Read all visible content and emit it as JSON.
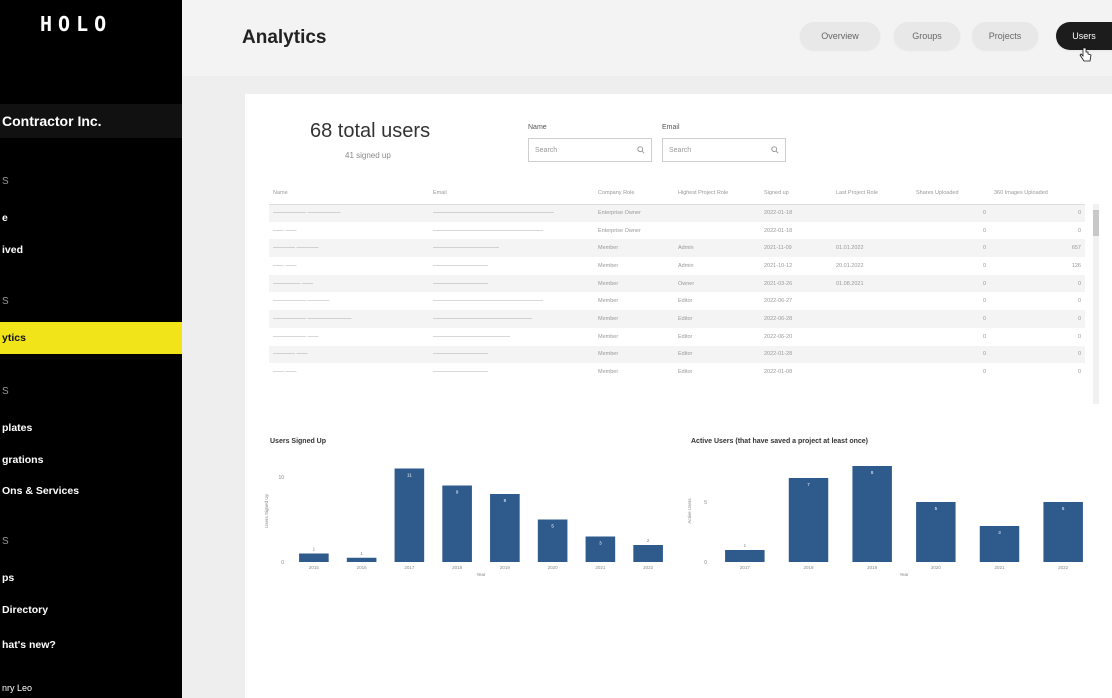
{
  "sidebar": {
    "logo": "HOLO",
    "org": "Contractor Inc.",
    "sections": [
      "S",
      "S",
      "S",
      "S"
    ],
    "items": [
      {
        "label": "e"
      },
      {
        "label": "ived"
      },
      {
        "label": "ytics"
      },
      {
        "label": "plates"
      },
      {
        "label": "grations"
      },
      {
        "label": "Ons & Services"
      },
      {
        "label": "ps"
      },
      {
        "label": "Directory"
      },
      {
        "label": "hat's new?"
      },
      {
        "label": "nry Leo"
      }
    ]
  },
  "header": {
    "title": "Analytics",
    "tabs": [
      {
        "label": "Overview"
      },
      {
        "label": "Groups"
      },
      {
        "label": "Projects"
      },
      {
        "label": "Users"
      }
    ],
    "active_tab": "Users"
  },
  "summary": {
    "total_users": "68 total users",
    "signed_up": "41 signed up"
  },
  "filters": {
    "name_label": "Name",
    "name_placeholder": "Search",
    "email_label": "Email",
    "email_placeholder": "Search"
  },
  "table": {
    "columns": [
      "Name",
      "Email",
      "Company Role",
      "Highest Project Role",
      "Signed up",
      "Last Project Role",
      "Shares Uploaded",
      "360 Images Uploaded"
    ],
    "rows": [
      [
        "—————— ——————",
        "——————————————————————",
        "Enterprise Owner",
        "",
        "2022-01-18",
        "",
        "0",
        "0"
      ],
      [
        "—— ——",
        "————————————————————",
        "Enterprise Owner",
        "",
        "2022-01-18",
        "",
        "0",
        "0"
      ],
      [
        "———— ————",
        "————————————",
        "Member",
        "Admin",
        "2021-11-09",
        "01.01.2022",
        "0",
        "657"
      ],
      [
        "—— ——",
        "——————————",
        "Member",
        "Admin",
        "2021-10-12",
        "20.01.2022",
        "0",
        "126"
      ],
      [
        "————— ——",
        "——————————",
        "Member",
        "Owner",
        "2021-03-26",
        "01.08.2021",
        "0",
        "0"
      ],
      [
        "—————— ————",
        "————————————————————",
        "Member",
        "Editor",
        "2022-06-27",
        "",
        "0",
        "0"
      ],
      [
        "—————— ————————",
        "——————————————————",
        "Member",
        "Editor",
        "2022-06-28",
        "",
        "0",
        "0"
      ],
      [
        "—————— ——",
        "——————————————",
        "Member",
        "Editor",
        "2022-06-20",
        "",
        "0",
        "0"
      ],
      [
        "———— ——",
        "——————————",
        "Member",
        "Editor",
        "2022-01-28",
        "",
        "0",
        "0"
      ],
      [
        "—— ——",
        "——————————",
        "Member",
        "Editor",
        "2022-01-08",
        "",
        "0",
        "0"
      ]
    ]
  },
  "chart_data": [
    {
      "type": "bar",
      "title": "Users Signed Up",
      "xlabel": "Year",
      "ylabel": "Users Signed Up",
      "categories": [
        "2015",
        "2016",
        "2017",
        "2018",
        "2019",
        "2020",
        "2021",
        "2022"
      ],
      "values": [
        1,
        0.5,
        11,
        9,
        8,
        5,
        3,
        2
      ],
      "value_labels": [
        "1",
        "1",
        "11",
        "9",
        "8",
        "5",
        "3",
        "2"
      ],
      "y_ticks": [
        0,
        10
      ],
      "ylim": [
        0,
        12
      ],
      "color": "#2f5a8c"
    },
    {
      "type": "bar",
      "title": "Active Users (that have saved a project at least once)",
      "xlabel": "Year",
      "ylabel": "Active Users",
      "categories": [
        "2017",
        "2018",
        "2019",
        "2020",
        "2021",
        "2022"
      ],
      "values": [
        1,
        7,
        8,
        5,
        3,
        5
      ],
      "value_labels": [
        "1",
        "7",
        "8",
        "5",
        "3",
        "5"
      ],
      "y_ticks": [
        0,
        5
      ],
      "ylim": [
        0,
        8.5
      ],
      "color": "#2f5a8c"
    }
  ]
}
